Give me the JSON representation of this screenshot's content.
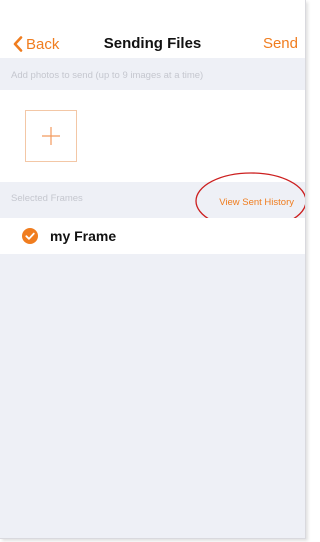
{
  "nav": {
    "back_label": "Back",
    "title": "Sending Files",
    "send_label": "Send"
  },
  "hint": "Add photos to send (up to 9 images at a time)",
  "photos": {
    "add_icon": "plus-icon"
  },
  "frames_section": {
    "label": "Selected Frames",
    "history_link": "View Sent History"
  },
  "frames": [
    {
      "name": "my Frame",
      "selected": true
    }
  ],
  "colors": {
    "accent": "#f07d1f",
    "annotation": "#cc1f1f",
    "background": "#eef0f6"
  }
}
